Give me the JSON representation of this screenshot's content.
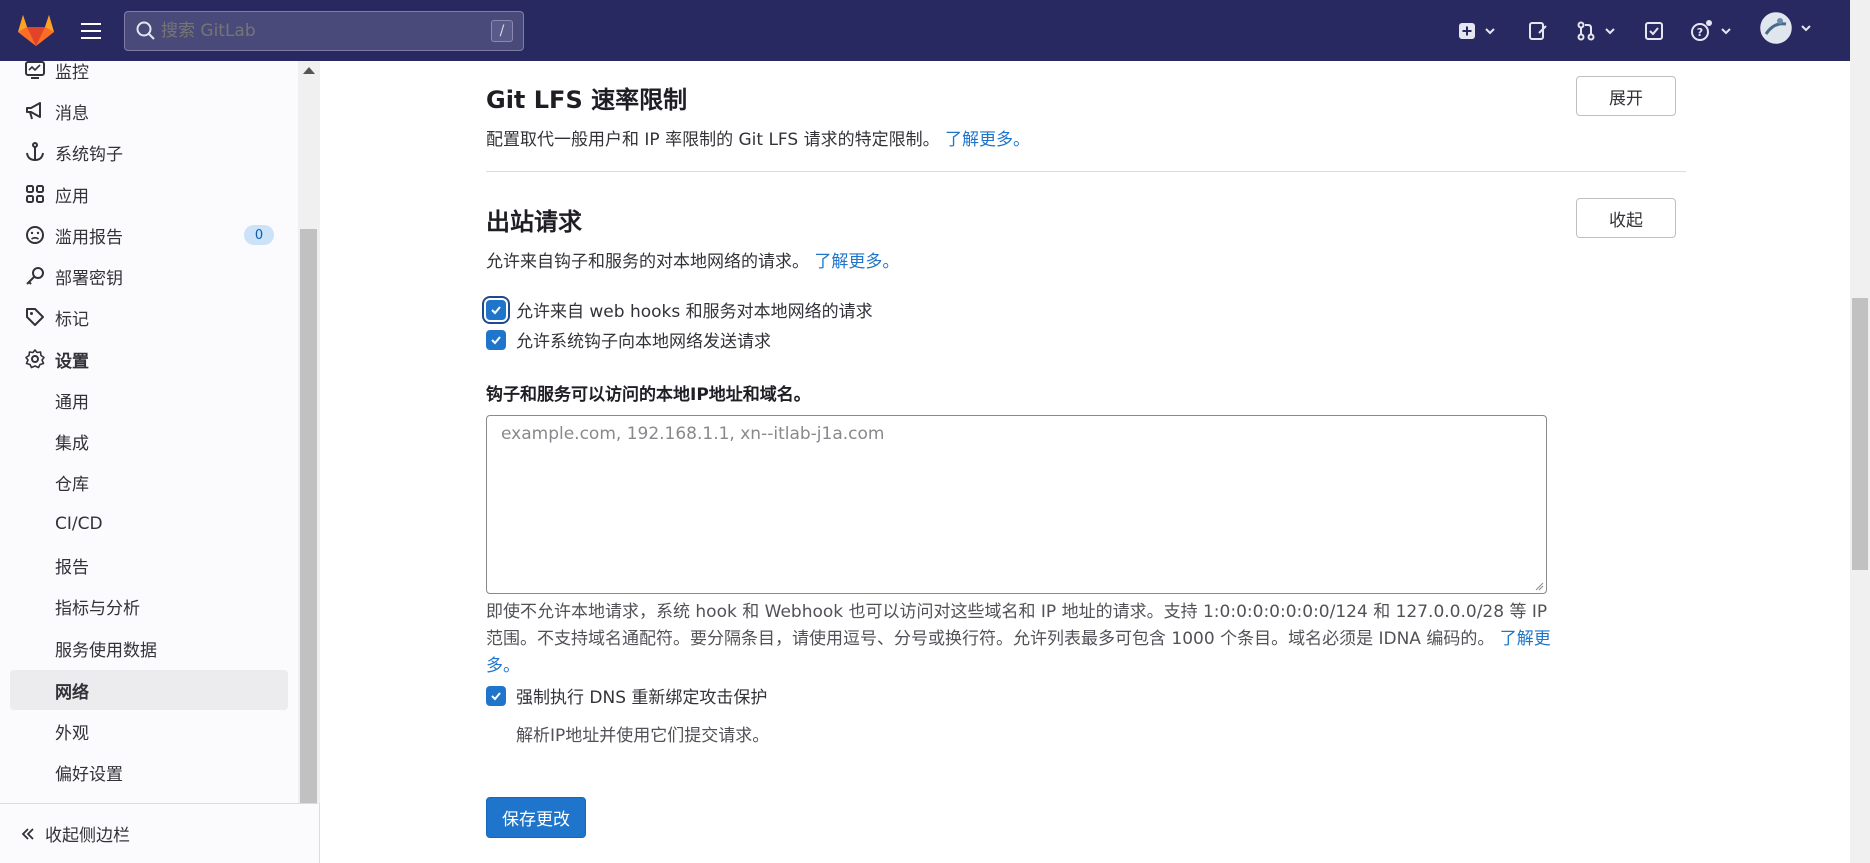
{
  "header": {
    "search_placeholder": "搜索 GitLab",
    "search_shortcut": "/",
    "brand_color": "#292961",
    "icons": [
      "gitlab-logo",
      "hamburger-icon",
      "search-icon",
      "plus-square-icon",
      "chevron-down-icon",
      "issues-icon",
      "merge-request-icon",
      "todo-icon",
      "help-icon",
      "avatar"
    ]
  },
  "sidebar": {
    "items": [
      {
        "label": "监控",
        "icon": "monitor-icon"
      },
      {
        "label": "消息",
        "icon": "bullhorn-icon"
      },
      {
        "label": "系统钩子",
        "icon": "anchor-icon"
      },
      {
        "label": "应用",
        "icon": "applications-icon"
      },
      {
        "label": "滥用报告",
        "icon": "slight-frown-icon",
        "badge": "0"
      },
      {
        "label": "部署密钥",
        "icon": "key-icon"
      },
      {
        "label": "标记",
        "icon": "label-icon"
      },
      {
        "label": "设置",
        "icon": "settings-icon"
      }
    ],
    "sub_items": [
      {
        "label": "通用"
      },
      {
        "label": "集成"
      },
      {
        "label": "仓库"
      },
      {
        "label": "CI/CD"
      },
      {
        "label": "报告"
      },
      {
        "label": "指标与分析"
      },
      {
        "label": "服务使用数据"
      },
      {
        "label": "网络",
        "active": true
      },
      {
        "label": "外观"
      },
      {
        "label": "偏好设置"
      }
    ],
    "collapse_label": "收起侧边栏"
  },
  "main": {
    "lfs": {
      "title": "Git LFS 速率限制",
      "desc": "配置取代一般用户和 IP 率限制的 Git LFS 请求的特定限制。",
      "link": "了解更多。",
      "button": "展开"
    },
    "outbound": {
      "title": "出站请求",
      "desc": "允许来自钩子和服务的对本地网络的请求。",
      "link": "了解更多。",
      "button": "收起",
      "checkbox1": "允许来自 web hooks 和服务对本地网络的请求",
      "checkbox2": "允许系统钩子向本地网络发送请求",
      "field_label": "钩子和服务可以访问的本地IP地址和域名。",
      "textarea_placeholder": "example.com, 192.168.1.1, xn--itlab-j1a.com",
      "help_line1": "即使不允许本地请求，系统 hook 和 Webhook 也可以访问对这些域名和 IP 地址的请求。支持 1:0:0:0:0:0:0:0/124 和 127.0.0.0/28 等 IP",
      "help_line2": "范围。不支持域名通配符。要分隔条目，请使用逗号、分号或换行符。允许列表最多可包含 1000 个条目。域名必须是 IDNA 编码的。",
      "help_link": "了解更多。",
      "checkbox3": "强制执行 DNS 重新绑定攻击保护",
      "checkbox3_help": "解析IP地址并使用它们提交请求。",
      "save_button": "保存更改"
    }
  }
}
